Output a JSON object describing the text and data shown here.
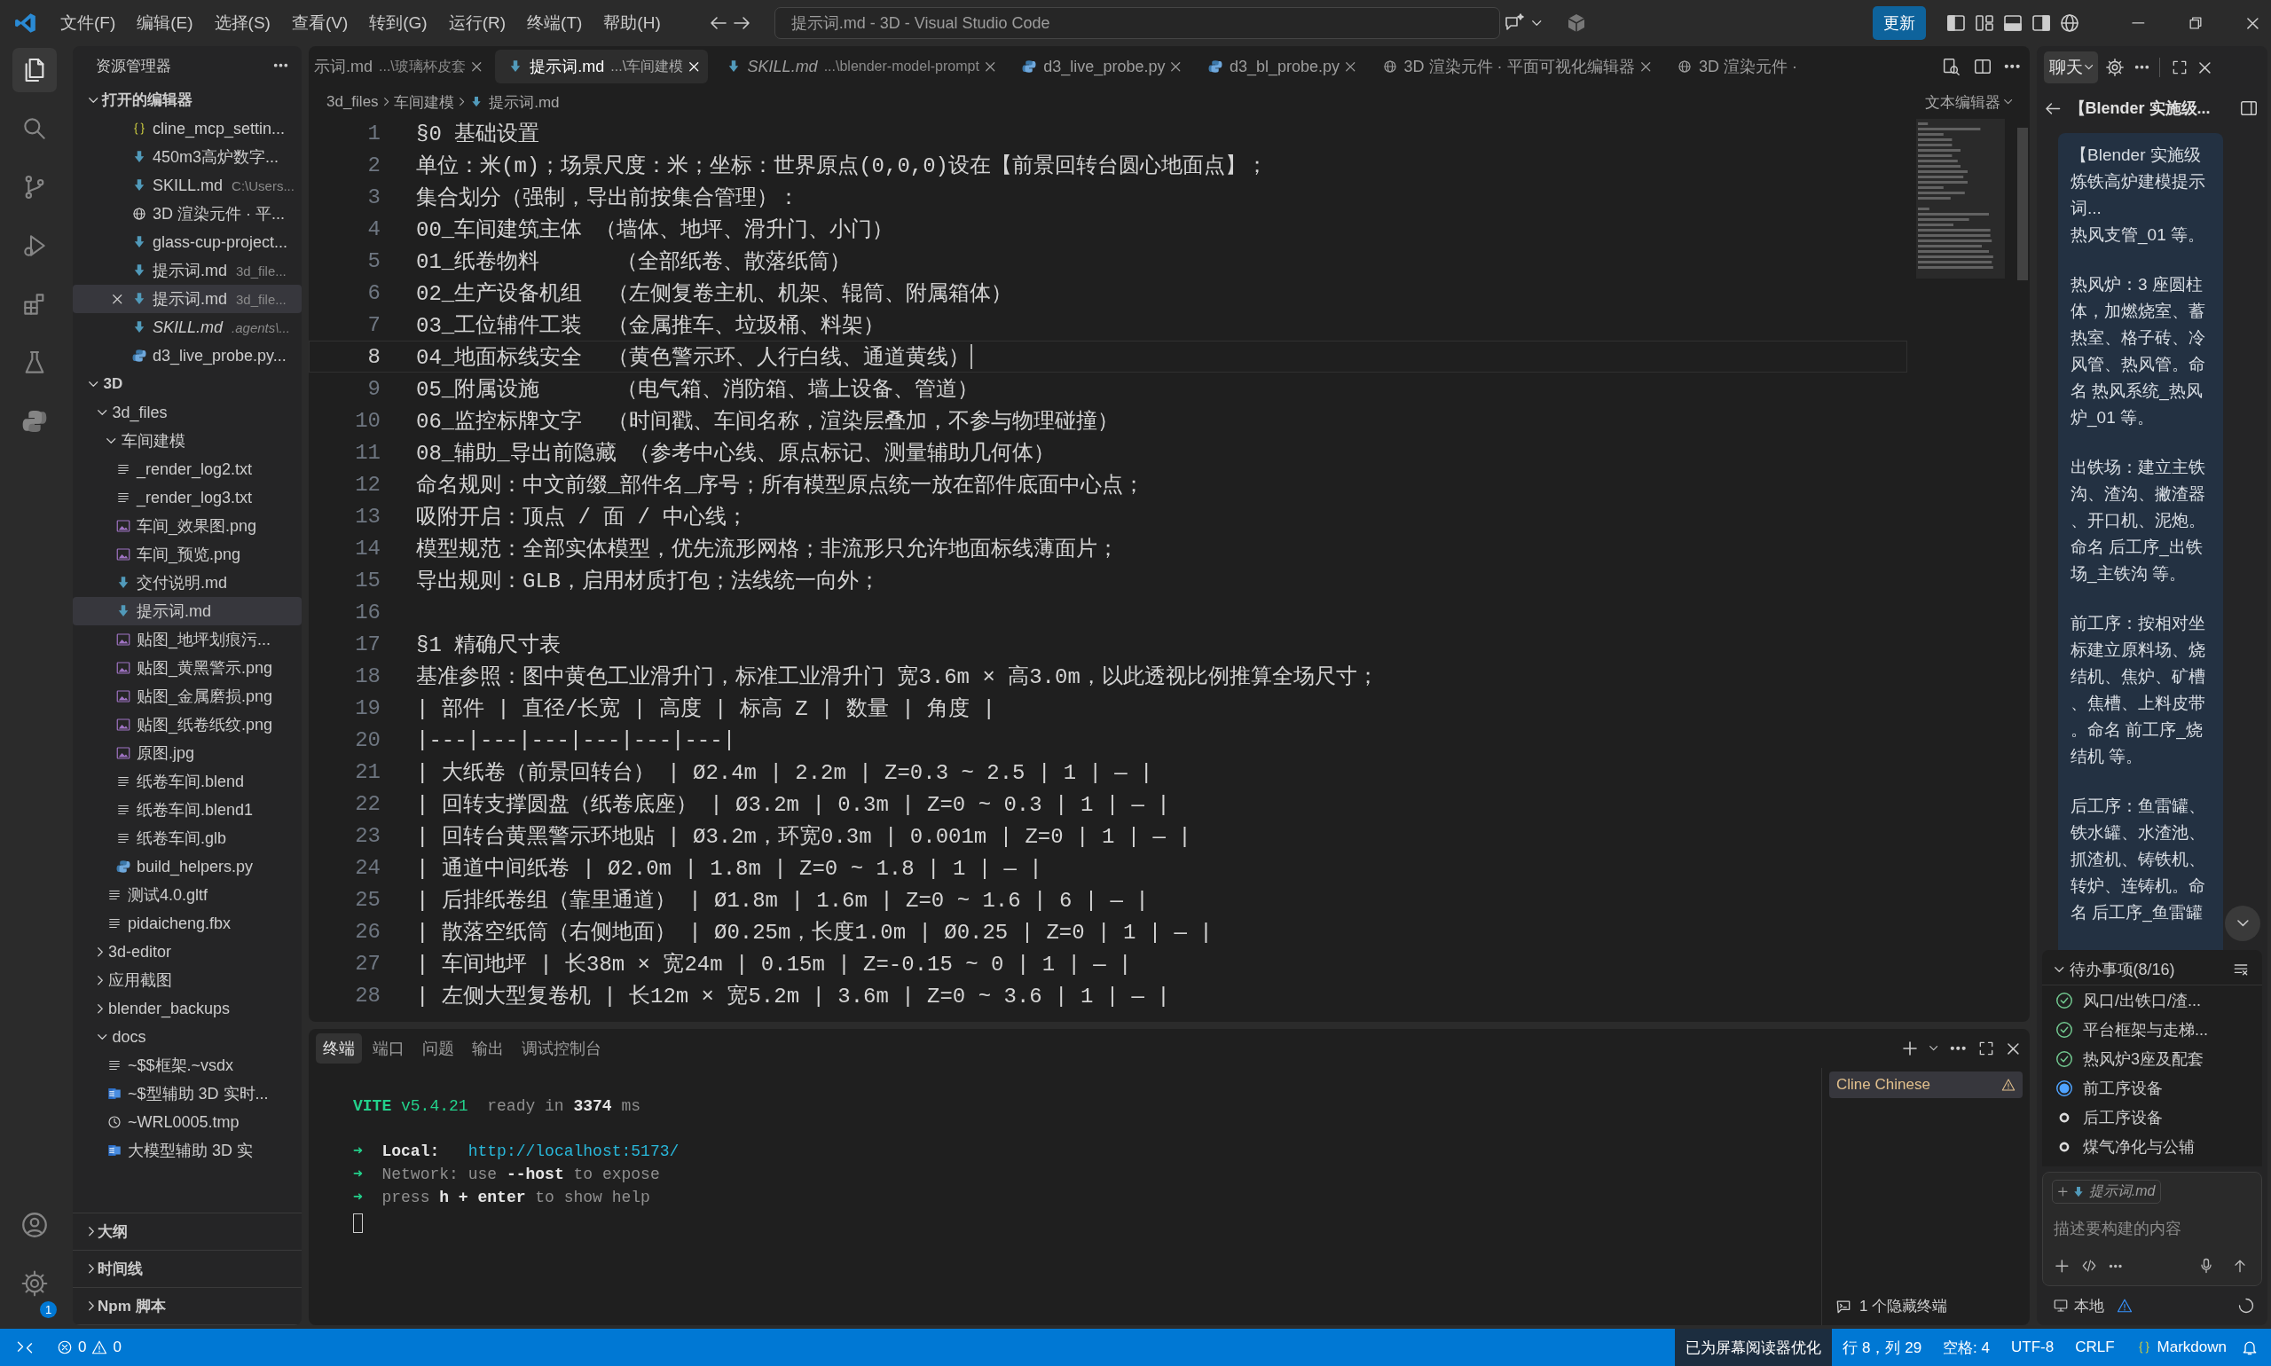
{
  "title_bar": {
    "menu": [
      "文件(F)",
      "编辑(E)",
      "选择(S)",
      "查看(V)",
      "转到(G)",
      "运行(R)",
      "终端(T)",
      "帮助(H)"
    ],
    "command_center": "提示词.md - 3D - Visual Studio Code",
    "update_button": "更新"
  },
  "activity_bar": {
    "items": [
      {
        "kind": "explorer",
        "selected": true
      },
      {
        "kind": "search",
        "selected": false
      },
      {
        "kind": "source-control",
        "selected": false
      },
      {
        "kind": "run-debug",
        "selected": false
      },
      {
        "kind": "extensions",
        "selected": false
      },
      {
        "kind": "testing",
        "selected": false
      },
      {
        "kind": "python",
        "selected": false
      }
    ],
    "settings_badge": "1"
  },
  "sidebar": {
    "title": "资源管理器",
    "open_editors": {
      "label": "打开的编辑器",
      "expanded": true,
      "items": [
        {
          "name": "cline_mcp_settin...",
          "kind": "json",
          "preview": false,
          "selected": false
        },
        {
          "name": "450m3高炉数字...",
          "kind": "markdown",
          "preview": false,
          "selected": false
        },
        {
          "name": "SKILL.md",
          "detail": "C:\\Users...",
          "kind": "markdown",
          "preview": false,
          "selected": false
        },
        {
          "name": "3D 渲染元件 · 平...",
          "kind": "web",
          "preview": false,
          "selected": false
        },
        {
          "name": "glass-cup-project...",
          "kind": "markdown",
          "preview": false,
          "selected": false
        },
        {
          "name": "提示词.md",
          "detail": "3d_file...",
          "kind": "markdown",
          "preview": false,
          "selected": false
        },
        {
          "name": "提示词.md",
          "detail": "3d_file...",
          "kind": "markdown",
          "preview": false,
          "selected": true
        },
        {
          "name": "SKILL.md",
          "detail": ".agents\\...",
          "kind": "markdown",
          "preview": true,
          "selected": false
        },
        {
          "name": "d3_live_probe.py...",
          "kind": "python",
          "preview": false,
          "selected": false
        }
      ]
    },
    "tree": [
      {
        "kind": "folder",
        "name": "3D",
        "expanded": true,
        "selected": false,
        "children": [
          {
            "kind": "folder",
            "name": "3d_files",
            "expanded": true,
            "selected": false,
            "children": [
              {
                "kind": "folder",
                "name": "车间建模",
                "expanded": true,
                "selected": false,
                "children": [
                  {
                    "kind": "text",
                    "name": "_render_log2.txt",
                    "selected": false
                  },
                  {
                    "kind": "text",
                    "name": "_render_log3.txt",
                    "selected": false
                  },
                  {
                    "kind": "image",
                    "name": "车间_效果图.png",
                    "selected": false
                  },
                  {
                    "kind": "image",
                    "name": "车间_预览.png",
                    "selected": false
                  },
                  {
                    "kind": "markdown",
                    "name": "交付说明.md",
                    "selected": false
                  },
                  {
                    "kind": "markdown",
                    "name": "提示词.md",
                    "selected": true
                  },
                  {
                    "kind": "image",
                    "name": "贴图_地坪划痕污...",
                    "selected": false
                  },
                  {
                    "kind": "image",
                    "name": "贴图_黄黑警示.png",
                    "selected": false
                  },
                  {
                    "kind": "image",
                    "name": "贴图_金属磨损.png",
                    "selected": false
                  },
                  {
                    "kind": "image",
                    "name": "贴图_纸卷纸纹.png",
                    "selected": false
                  },
                  {
                    "kind": "image",
                    "name": "原图.jpg",
                    "selected": false
                  },
                  {
                    "kind": "text",
                    "name": "纸卷车间.blend",
                    "selected": false
                  },
                  {
                    "kind": "text",
                    "name": "纸卷车间.blend1",
                    "selected": false
                  },
                  {
                    "kind": "text",
                    "name": "纸卷车间.glb",
                    "selected": false
                  },
                  {
                    "kind": "python",
                    "name": "build_helpers.py",
                    "selected": false
                  }
                ]
              },
              {
                "kind": "text",
                "name": "测试4.0.gltf",
                "selected": false
              },
              {
                "kind": "text",
                "name": "pidaicheng.fbx",
                "selected": false
              }
            ]
          },
          {
            "kind": "folder",
            "name": "3d-editor",
            "expanded": false,
            "selected": false
          },
          {
            "kind": "folder",
            "name": "应用截图",
            "expanded": false,
            "selected": false
          },
          {
            "kind": "folder",
            "name": "blender_backups",
            "expanded": false,
            "selected": false
          },
          {
            "kind": "folder",
            "name": "docs",
            "expanded": true,
            "selected": false,
            "children": [
              {
                "kind": "text",
                "name": "~$$框架.~vsdx",
                "selected": false
              },
              {
                "kind": "word",
                "name": "~$型辅助 3D 实时...",
                "selected": false
              },
              {
                "kind": "temp",
                "name": "~WRL0005.tmp",
                "selected": false
              },
              {
                "kind": "word",
                "name": "大模型辅助 3D 实",
                "selected": false
              }
            ]
          }
        ]
      }
    ],
    "sections": [
      {
        "label": "大纲",
        "expanded": false
      },
      {
        "label": "时间线",
        "expanded": false
      },
      {
        "label": "Npm 脚本",
        "expanded": false
      }
    ]
  },
  "editor": {
    "tabs": [
      {
        "name": "示词.md",
        "detail": "...\\玻璃杯皮套",
        "selected": false,
        "preview": false,
        "closable": true
      },
      {
        "name": "提示词.md",
        "detail": "...\\车间建模",
        "kind": "markdown",
        "selected": true,
        "preview": false,
        "closable": true
      },
      {
        "name": "SKILL.md",
        "detail": "...\\blender-model-prompt",
        "kind": "markdown",
        "selected": false,
        "preview": true,
        "closable": true
      },
      {
        "name": "d3_live_probe.py",
        "kind": "python",
        "selected": false,
        "preview": false,
        "closable": true
      },
      {
        "name": "d3_bl_probe.py",
        "kind": "python",
        "selected": false,
        "preview": false,
        "closable": true
      },
      {
        "name": "3D 渲染元件 · 平面可视化编辑器",
        "kind": "web",
        "selected": false,
        "preview": false,
        "closable": true
      },
      {
        "name": "3D 渲染元件 ·",
        "kind": "web",
        "selected": false,
        "preview": false,
        "closable": false
      }
    ],
    "breadcrumb": [
      "3d_files",
      "车间建模",
      "提示词.md"
    ],
    "editor_mode": "文本编辑器",
    "lines": [
      {
        "n": "1",
        "text": "§0 基础设置",
        "current": false
      },
      {
        "n": "2",
        "text": "单位：米(m)；场景尺度：米；坐标：世界原点(0,0,0)设在【前景回转台圆心地面点】；",
        "current": false
      },
      {
        "n": "3",
        "text": "集合划分（强制，导出前按集合管理）：",
        "current": false
      },
      {
        "n": "4",
        "text": "00_车间建筑主体 （墙体、地坪、滑升门、小门）",
        "current": false
      },
      {
        "n": "5",
        "text": "01_纸卷物料      （全部纸卷、散落纸筒）",
        "current": false
      },
      {
        "n": "6",
        "text": "02_生产设备机组  （左侧复卷主机、机架、辊筒、附属箱体）",
        "current": false
      },
      {
        "n": "7",
        "text": "03_工位辅件工装  （金属推车、垃圾桶、料架）",
        "current": false
      },
      {
        "n": "8",
        "text": "04_地面标线安全  （黄色警示环、人行白线、通道黄线）",
        "current": true
      },
      {
        "n": "9",
        "text": "05_附属设施      （电气箱、消防箱、墙上设备、管道）",
        "current": false
      },
      {
        "n": "10",
        "text": "06_监控标牌文字  （时间戳、车间名称，渲染层叠加，不参与物理碰撞）",
        "current": false
      },
      {
        "n": "11",
        "text": "08_辅助_导出前隐藏 （参考中心线、原点标记、测量辅助几何体）",
        "current": false
      },
      {
        "n": "12",
        "text": "命名规则：中文前缀_部件名_序号；所有模型原点统一放在部件底面中心点；",
        "current": false
      },
      {
        "n": "13",
        "text": "吸附开启：顶点 / 面 / 中心线；",
        "current": false
      },
      {
        "n": "14",
        "text": "模型规范：全部实体模型，优先流形网格；非流形只允许地面标线薄面片；",
        "current": false
      },
      {
        "n": "15",
        "text": "导出规则：GLB，启用材质打包；法线统一向外；",
        "current": false
      },
      {
        "n": "16",
        "current": false
      },
      {
        "n": "17",
        "text": "§1 精确尺寸表",
        "current": false
      },
      {
        "n": "18",
        "text": "基准参照：图中黄色工业滑升门，标准工业滑升门 宽3.6m × 高3.0m，以此透视比例推算全场尺寸；",
        "current": false
      },
      {
        "n": "19",
        "text": "| 部件 | 直径/长宽 | 高度 | 标高 Z | 数量 | 角度 |",
        "current": false
      },
      {
        "n": "20",
        "text": "|---|---|---|---|---|---|",
        "current": false
      },
      {
        "n": "21",
        "text": "| 大纸卷（前景回转台） | Ø2.4m | 2.2m | Z=0.3 ~ 2.5 | 1 | — |",
        "current": false
      },
      {
        "n": "22",
        "text": "| 回转支撑圆盘（纸卷底座） | Ø3.2m | 0.3m | Z=0 ~ 0.3 | 1 | — |",
        "current": false
      },
      {
        "n": "23",
        "text": "| 回转台黄黑警示环地贴 | Ø3.2m，环宽0.3m | 0.001m | Z=0 | 1 | — |",
        "current": false
      },
      {
        "n": "24",
        "text": "| 通道中间纸卷 | Ø2.0m | 1.8m | Z=0 ~ 1.8 | 1 | — |",
        "current": false
      },
      {
        "n": "25",
        "text": "| 后排纸卷组（靠里通道） | Ø1.8m | 1.6m | Z=0 ~ 1.6 | 6 | — |",
        "current": false
      },
      {
        "n": "26",
        "text": "| 散落空纸筒（右侧地面） | Ø0.25m，长度1.0m | Ø0.25 | Z=0 | 1 | — |",
        "current": false
      },
      {
        "n": "27",
        "text": "| 车间地坪 | 长38m × 宽24m | 0.15m | Z=-0.15 ~ 0 | 1 | — |",
        "current": false
      },
      {
        "n": "28",
        "text": "| 左侧大型复卷机 | 长12m × 宽5.2m | 3.6m | Z=0 ~ 3.6 | 1 | — |",
        "current": false
      }
    ]
  },
  "panel": {
    "tabs": [
      {
        "label": "终端",
        "selected": true
      },
      {
        "label": "端口",
        "selected": false
      },
      {
        "label": "问题",
        "selected": false
      },
      {
        "label": "输出",
        "selected": false
      },
      {
        "label": "调试控制台",
        "selected": false
      }
    ],
    "terminal_lines": [
      [
        {
          "text": "VITE",
          "kind": "brand-strong"
        },
        {
          "text": " v5.4.21",
          "kind": "brand"
        },
        {
          "text": "  ready in ",
          "kind": "muted"
        },
        {
          "text": "3374",
          "kind": "strong"
        },
        {
          "text": " ms",
          "kind": "muted"
        }
      ],
      [
        {
          "text": "➜",
          "kind": "prompt"
        },
        {
          "text": "  Local:   ",
          "kind": "strong"
        },
        {
          "text": "http://localhost:5173/",
          "kind": "link"
        }
      ],
      [
        {
          "text": "➜",
          "kind": "prompt"
        },
        {
          "text": "  Network: use ",
          "kind": "muted"
        },
        {
          "text": "--host",
          "kind": "strong"
        },
        {
          "text": " to expose",
          "kind": "muted"
        }
      ],
      [
        {
          "text": "➜",
          "kind": "prompt"
        },
        {
          "text": "  press ",
          "kind": "muted"
        },
        {
          "text": "h + enter",
          "kind": "strong"
        },
        {
          "text": " to show help",
          "kind": "muted"
        }
      ]
    ],
    "terminals": [
      {
        "name": "Cline Chinese",
        "selected": true,
        "warning": true
      }
    ],
    "hidden_terminals": "1 个隐藏终端"
  },
  "chat": {
    "tab": "聊天",
    "title": "【Blender 实施级...",
    "message": {
      "heading": "【Blender 实施级炼铁高炉建模提示词...",
      "paragraphs": [
        "热风支管_01 等。",
        "热风炉：3 座圆柱体，加燃烧室、蓄热室、格子砖、冷风管、热风管。命名 热风系统_热风炉_01 等。",
        "出铁场：建立主铁沟、渣沟、撇渣器、开口机、泥炮。命名 后工序_出铁场_主铁沟 等。",
        "前工序：按相对坐标建立原料场、烧结机、焦炉、矿槽、焦槽、上料皮带。命名 前工序_烧结机 等。",
        "后工序：鱼雷罐、铁水罐、水渣池、抓渣机、铸铁机、转炉、连铸机。命名 后工序_鱼雷罐"
      ]
    },
    "todos": {
      "label": "待办事项(8/16)",
      "expanded": true,
      "items": [
        {
          "text": "风口/出铁口/渣...",
          "kind": "done"
        },
        {
          "text": "平台框架与走梯...",
          "kind": "done"
        },
        {
          "text": "热风炉3座及配套",
          "kind": "done"
        },
        {
          "text": "前工序设备",
          "kind": "active"
        },
        {
          "text": "后工序设备",
          "kind": "pending"
        },
        {
          "text": "煤气净化与公辅",
          "kind": "pending"
        }
      ]
    },
    "attachment": "提示词.md",
    "input": {
      "placeholder": "描述要构建的内容"
    },
    "mode": "本地"
  },
  "status_bar": {
    "errors": "0",
    "warnings": "0",
    "items": [
      {
        "text": "已为屏幕阅读器优化",
        "kind": "highlight"
      },
      {
        "text": "行 8，列 29",
        "kind": "plain"
      },
      {
        "text": "空格: 4",
        "kind": "plain"
      },
      {
        "text": "UTF-8",
        "kind": "plain"
      },
      {
        "text": "CRLF",
        "kind": "plain"
      },
      {
        "text": "Markdown",
        "kind": "language"
      }
    ]
  }
}
